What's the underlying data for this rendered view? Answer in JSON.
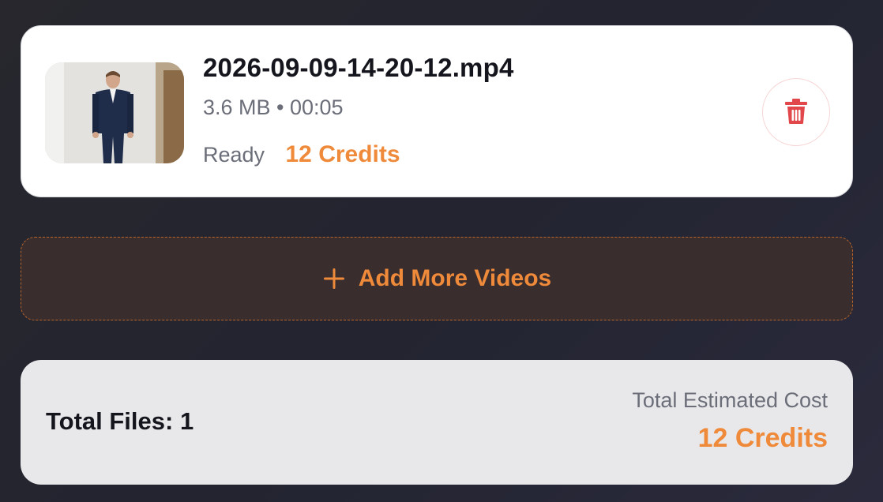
{
  "file": {
    "name": "2026-09-09-14-20-12.mp4",
    "meta": "3.6 MB • 00:05",
    "status": "Ready",
    "credits": "12 Credits",
    "thumbnail_icon": "video-thumbnail-person"
  },
  "delete": {
    "icon": "trash-icon",
    "color": "#e2474b"
  },
  "add_more": {
    "label": "Add More Videos",
    "icon": "plus-icon"
  },
  "summary": {
    "total_files": "Total Files: 1",
    "cost_label": "Total Estimated Cost",
    "cost_value": "12 Credits"
  },
  "colors": {
    "accent": "#ef8a3a",
    "danger": "#e2474b",
    "text_primary": "#15161d",
    "text_secondary": "#6b6e78"
  }
}
